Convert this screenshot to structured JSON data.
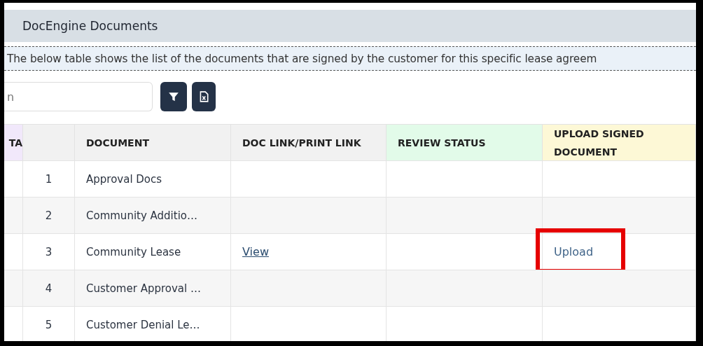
{
  "panel": {
    "title": "DocEngine Documents"
  },
  "info": "The below table shows the list of the documents that are signed by the customer for this specific lease agreem",
  "search": {
    "placeholder": "n"
  },
  "toolbar": [
    {
      "kind": "filter"
    },
    {
      "kind": "excel"
    }
  ],
  "table": {
    "columns": [
      {
        "label": "TA",
        "color": "#f1e8fb"
      },
      {
        "color": "#f1f1f1"
      },
      {
        "label": "DOCUMENT",
        "color": "#f1f1f1"
      },
      {
        "label": "DOC LINK/PRINT LINK",
        "color": "#f1f1f1"
      },
      {
        "label": "REVIEW STATUS",
        "color": "#e2fbe9"
      },
      {
        "label": "UPLOAD SIGNED DOCUMENT",
        "color": "#fdf8d6"
      }
    ],
    "rows": [
      {
        "number": "1",
        "document": "Approval Docs",
        "highlighted": false
      },
      {
        "number": "2",
        "document": "Community Additio…",
        "highlighted": false
      },
      {
        "number": "3",
        "document": "Community Lease",
        "link": "View",
        "upload": "Upload",
        "highlighted": true
      },
      {
        "number": "4",
        "document": "Customer Approval …",
        "highlighted": false
      },
      {
        "number": "5",
        "document": "Customer Denial Le…",
        "highlighted": false
      }
    ]
  }
}
